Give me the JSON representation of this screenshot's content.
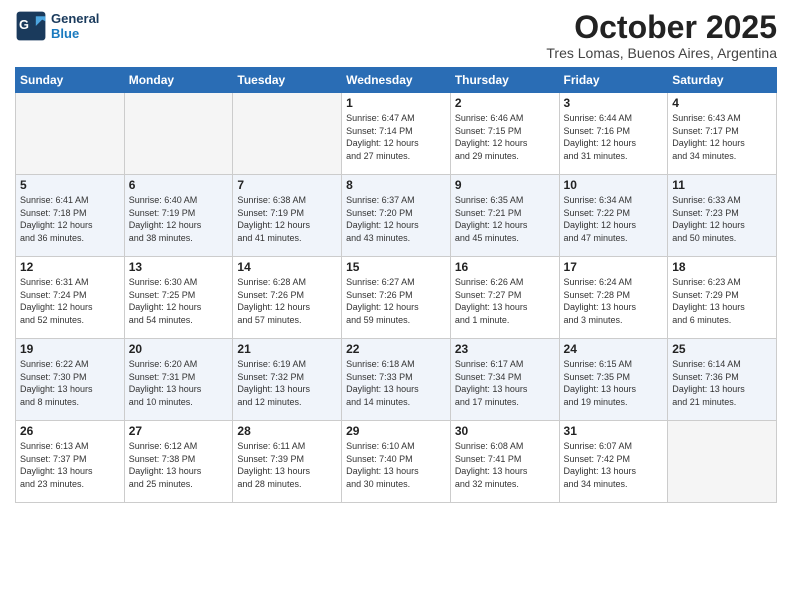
{
  "logo": {
    "line1": "General",
    "line2": "Blue"
  },
  "title": "October 2025",
  "subtitle": "Tres Lomas, Buenos Aires, Argentina",
  "days_header": [
    "Sunday",
    "Monday",
    "Tuesday",
    "Wednesday",
    "Thursday",
    "Friday",
    "Saturday"
  ],
  "weeks": [
    [
      {
        "num": "",
        "info": ""
      },
      {
        "num": "",
        "info": ""
      },
      {
        "num": "",
        "info": ""
      },
      {
        "num": "1",
        "info": "Sunrise: 6:47 AM\nSunset: 7:14 PM\nDaylight: 12 hours\nand 27 minutes."
      },
      {
        "num": "2",
        "info": "Sunrise: 6:46 AM\nSunset: 7:15 PM\nDaylight: 12 hours\nand 29 minutes."
      },
      {
        "num": "3",
        "info": "Sunrise: 6:44 AM\nSunset: 7:16 PM\nDaylight: 12 hours\nand 31 minutes."
      },
      {
        "num": "4",
        "info": "Sunrise: 6:43 AM\nSunset: 7:17 PM\nDaylight: 12 hours\nand 34 minutes."
      }
    ],
    [
      {
        "num": "5",
        "info": "Sunrise: 6:41 AM\nSunset: 7:18 PM\nDaylight: 12 hours\nand 36 minutes."
      },
      {
        "num": "6",
        "info": "Sunrise: 6:40 AM\nSunset: 7:19 PM\nDaylight: 12 hours\nand 38 minutes."
      },
      {
        "num": "7",
        "info": "Sunrise: 6:38 AM\nSunset: 7:19 PM\nDaylight: 12 hours\nand 41 minutes."
      },
      {
        "num": "8",
        "info": "Sunrise: 6:37 AM\nSunset: 7:20 PM\nDaylight: 12 hours\nand 43 minutes."
      },
      {
        "num": "9",
        "info": "Sunrise: 6:35 AM\nSunset: 7:21 PM\nDaylight: 12 hours\nand 45 minutes."
      },
      {
        "num": "10",
        "info": "Sunrise: 6:34 AM\nSunset: 7:22 PM\nDaylight: 12 hours\nand 47 minutes."
      },
      {
        "num": "11",
        "info": "Sunrise: 6:33 AM\nSunset: 7:23 PM\nDaylight: 12 hours\nand 50 minutes."
      }
    ],
    [
      {
        "num": "12",
        "info": "Sunrise: 6:31 AM\nSunset: 7:24 PM\nDaylight: 12 hours\nand 52 minutes."
      },
      {
        "num": "13",
        "info": "Sunrise: 6:30 AM\nSunset: 7:25 PM\nDaylight: 12 hours\nand 54 minutes."
      },
      {
        "num": "14",
        "info": "Sunrise: 6:28 AM\nSunset: 7:26 PM\nDaylight: 12 hours\nand 57 minutes."
      },
      {
        "num": "15",
        "info": "Sunrise: 6:27 AM\nSunset: 7:26 PM\nDaylight: 12 hours\nand 59 minutes."
      },
      {
        "num": "16",
        "info": "Sunrise: 6:26 AM\nSunset: 7:27 PM\nDaylight: 13 hours\nand 1 minute."
      },
      {
        "num": "17",
        "info": "Sunrise: 6:24 AM\nSunset: 7:28 PM\nDaylight: 13 hours\nand 3 minutes."
      },
      {
        "num": "18",
        "info": "Sunrise: 6:23 AM\nSunset: 7:29 PM\nDaylight: 13 hours\nand 6 minutes."
      }
    ],
    [
      {
        "num": "19",
        "info": "Sunrise: 6:22 AM\nSunset: 7:30 PM\nDaylight: 13 hours\nand 8 minutes."
      },
      {
        "num": "20",
        "info": "Sunrise: 6:20 AM\nSunset: 7:31 PM\nDaylight: 13 hours\nand 10 minutes."
      },
      {
        "num": "21",
        "info": "Sunrise: 6:19 AM\nSunset: 7:32 PM\nDaylight: 13 hours\nand 12 minutes."
      },
      {
        "num": "22",
        "info": "Sunrise: 6:18 AM\nSunset: 7:33 PM\nDaylight: 13 hours\nand 14 minutes."
      },
      {
        "num": "23",
        "info": "Sunrise: 6:17 AM\nSunset: 7:34 PM\nDaylight: 13 hours\nand 17 minutes."
      },
      {
        "num": "24",
        "info": "Sunrise: 6:15 AM\nSunset: 7:35 PM\nDaylight: 13 hours\nand 19 minutes."
      },
      {
        "num": "25",
        "info": "Sunrise: 6:14 AM\nSunset: 7:36 PM\nDaylight: 13 hours\nand 21 minutes."
      }
    ],
    [
      {
        "num": "26",
        "info": "Sunrise: 6:13 AM\nSunset: 7:37 PM\nDaylight: 13 hours\nand 23 minutes."
      },
      {
        "num": "27",
        "info": "Sunrise: 6:12 AM\nSunset: 7:38 PM\nDaylight: 13 hours\nand 25 minutes."
      },
      {
        "num": "28",
        "info": "Sunrise: 6:11 AM\nSunset: 7:39 PM\nDaylight: 13 hours\nand 28 minutes."
      },
      {
        "num": "29",
        "info": "Sunrise: 6:10 AM\nSunset: 7:40 PM\nDaylight: 13 hours\nand 30 minutes."
      },
      {
        "num": "30",
        "info": "Sunrise: 6:08 AM\nSunset: 7:41 PM\nDaylight: 13 hours\nand 32 minutes."
      },
      {
        "num": "31",
        "info": "Sunrise: 6:07 AM\nSunset: 7:42 PM\nDaylight: 13 hours\nand 34 minutes."
      },
      {
        "num": "",
        "info": ""
      }
    ]
  ]
}
